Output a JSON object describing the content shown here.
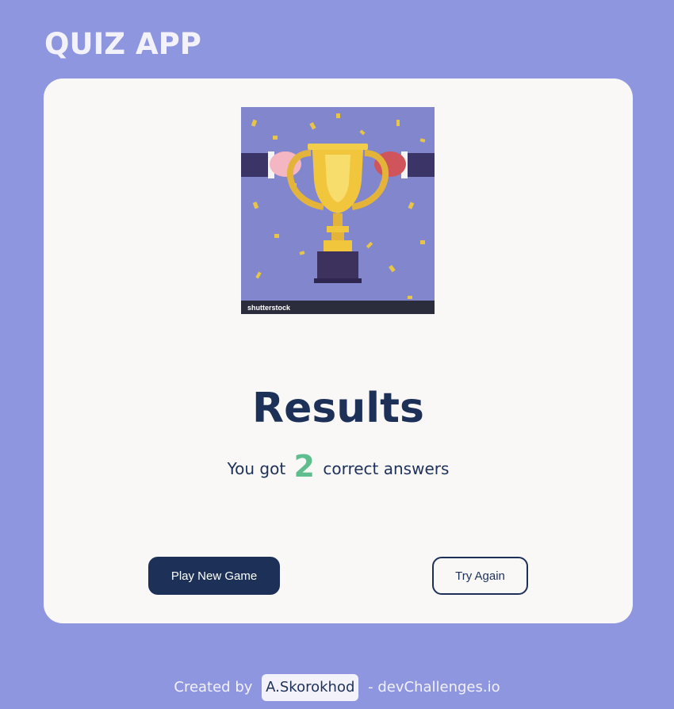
{
  "app": {
    "title": "QUIZ APP"
  },
  "results": {
    "image": {
      "watermark": "shutterstock",
      "icon": "trophy-with-boxing-gloves-icon"
    },
    "title": "Results",
    "score_prefix": "You got",
    "score": "2",
    "score_suffix": "correct answers"
  },
  "buttons": {
    "play_new_game": "Play New Game",
    "try_again": "Try Again"
  },
  "footer": {
    "prefix": "Created by",
    "author": "A.Skorokhod",
    "suffix": "- devChallenges.io"
  },
  "colors": {
    "background": "#8e96df",
    "card": "#faf8f7",
    "navy": "#1d3158",
    "score_green": "#60be8e"
  }
}
